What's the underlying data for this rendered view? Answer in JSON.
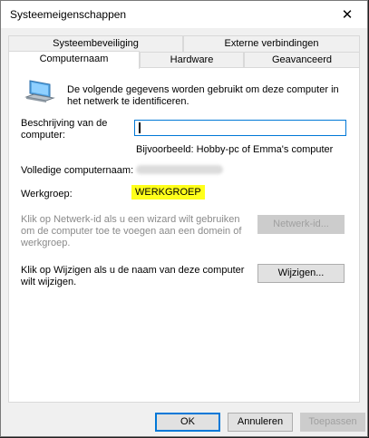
{
  "window": {
    "title": "Systeemeigenschappen",
    "close_glyph": "✕"
  },
  "tabs": {
    "row_top": [
      "Systeembeveiliging",
      "Externe verbindingen"
    ],
    "row_bottom": [
      "Computernaam",
      "Hardware",
      "Geavanceerd"
    ],
    "active": "Computernaam"
  },
  "content": {
    "intro": "De volgende gegevens worden gebruikt om deze computer in het netwerk te identificeren.",
    "description_label": "Beschrijving van de computer:",
    "description_value": "",
    "example": "Bijvoorbeeld: Hobby-pc of Emma's computer",
    "full_name_label": "Volledige computernaam:",
    "workgroup_label": "Werkgroep:",
    "workgroup_value": "WERKGROEP",
    "network_text": "Klik op Netwerk-id als u een wizard wilt gebruiken om de computer toe te voegen aan een domein of werkgroep.",
    "network_button": "Netwerk-id...",
    "change_text": "Klik op Wijzigen als u de naam van deze computer wilt wijzigen.",
    "change_button": "Wijzigen..."
  },
  "footer": {
    "ok": "OK",
    "cancel": "Annuleren",
    "apply": "Toepassen"
  },
  "icons": {
    "computer": "computer-icon",
    "close": "close-icon"
  },
  "colors": {
    "highlight": "#ffff1a",
    "focus_border": "#0078d7"
  }
}
